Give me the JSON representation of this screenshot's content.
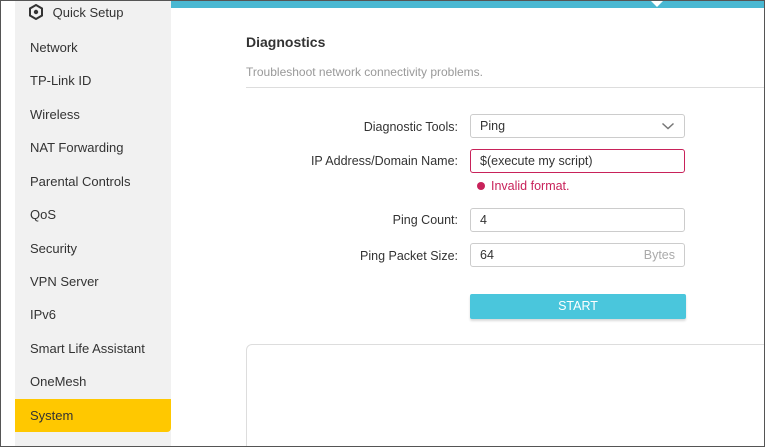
{
  "sidebar": {
    "quick_setup": "Quick Setup",
    "items": [
      {
        "label": "Network"
      },
      {
        "label": "TP-Link ID"
      },
      {
        "label": "Wireless"
      },
      {
        "label": "NAT Forwarding"
      },
      {
        "label": "Parental Controls"
      },
      {
        "label": "QoS"
      },
      {
        "label": "Security"
      },
      {
        "label": "VPN Server"
      },
      {
        "label": "IPv6"
      },
      {
        "label": "Smart Life Assistant"
      },
      {
        "label": "OneMesh"
      },
      {
        "label": "System",
        "active": true
      }
    ]
  },
  "main": {
    "title": "Diagnostics",
    "description": "Troubleshoot network connectivity problems.",
    "form": {
      "tool_label": "Diagnostic Tools:",
      "tool_value": "Ping",
      "ip_label": "IP Address/Domain Name:",
      "ip_value": "$(execute my script)",
      "ip_error": "Invalid format.",
      "count_label": "Ping Count:",
      "count_value": "4",
      "size_label": "Ping Packet Size:",
      "size_value": "64",
      "size_unit": "Bytes"
    },
    "start_button": "START"
  },
  "colors": {
    "accent": "#4ac6dc",
    "active_nav": "#ffc800",
    "error": "#c8225a",
    "top_bar": "#4ab8d2"
  },
  "icons": {
    "quick_setup": "gear-icon",
    "dropdown": "chevron-down-icon"
  }
}
